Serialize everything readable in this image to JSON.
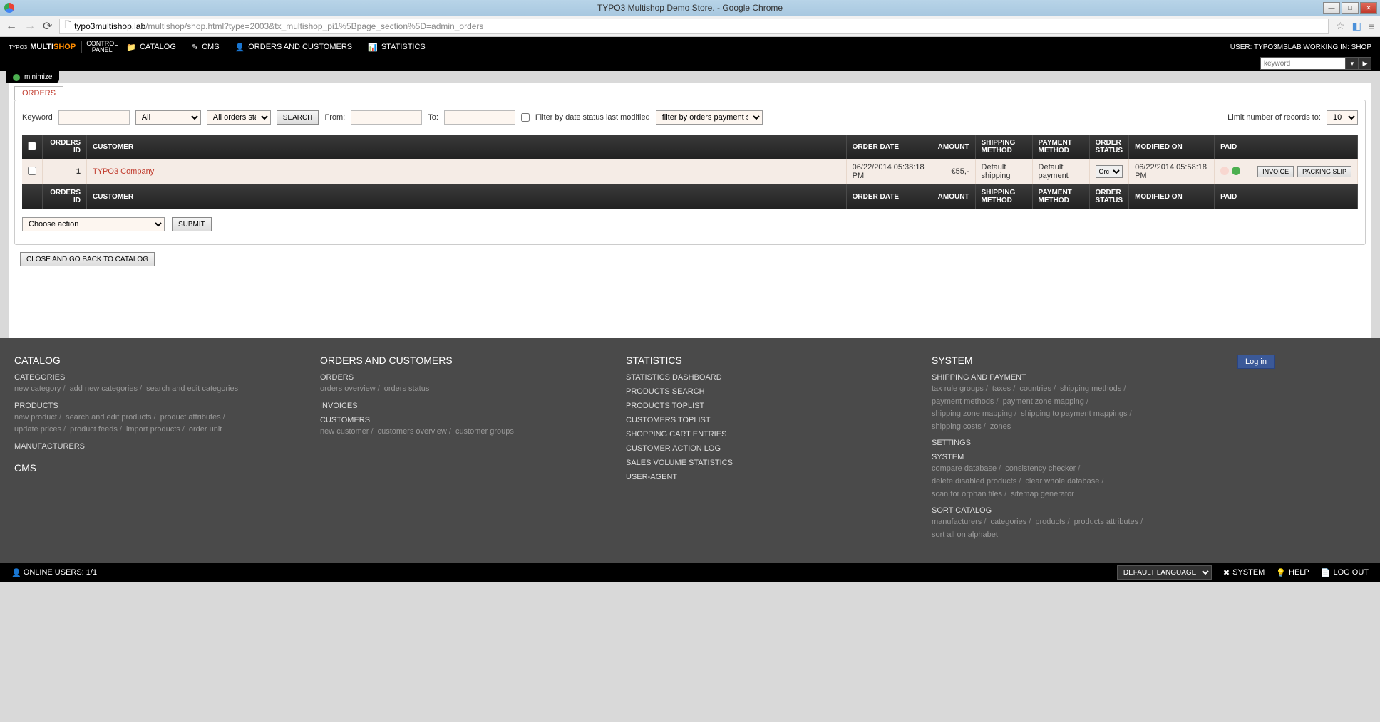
{
  "browser": {
    "title": "TYPO3 Multishop Demo Store. - Google Chrome",
    "url_host": "typo3multishop.lab",
    "url_path": "/multishop/shop.html?type=2003&tx_multishop_pi1%5Bpage_section%5D=admin_orders"
  },
  "topbar": {
    "logo_multi": "MULTI",
    "logo_shop": "SHOP",
    "control": "CONTROL",
    "panel": "PANEL",
    "nav": {
      "catalog": "CATALOG",
      "cms": "CMS",
      "orders": "ORDERS AND CUSTOMERS",
      "stats": "STATISTICS"
    },
    "user_label": "USER: TYPO3MSLAB WORKING IN: SHOP",
    "search_placeholder": "keyword",
    "minimize": "minimize"
  },
  "orders_tab": "ORDERS",
  "filters": {
    "keyword_label": "Keyword",
    "type_select": "All",
    "status_select": "All orders status",
    "search_btn": "SEARCH",
    "from_label": "From:",
    "to_label": "To:",
    "filter_date_label": "Filter by date status last modified",
    "payment_status_select": "filter by orders payment status",
    "limit_label": "Limit number of records to:",
    "limit_value": "10"
  },
  "table": {
    "headers": {
      "orders_id": "ORDERS ID",
      "customer": "CUSTOMER",
      "order_date": "ORDER DATE",
      "amount": "AMOUNT",
      "shipping": "SHIPPING METHOD",
      "payment": "PAYMENT METHOD",
      "status": "ORDER STATUS",
      "modified": "MODIFIED ON",
      "paid": "PAID"
    },
    "row": {
      "id": "1",
      "customer": "TYPO3 Company",
      "date": "06/22/2014 05:38:18 PM",
      "amount": "€55,-",
      "shipping": "Default shipping",
      "payment": "Default payment",
      "status": "Orc",
      "modified": "06/22/2014 05:58:18 PM",
      "invoice_btn": "INVOICE",
      "packing_btn": "PACKING SLIP"
    }
  },
  "actions": {
    "choose": "Choose action",
    "submit": "SUBMIT",
    "close": "CLOSE AND GO BACK TO CATALOG"
  },
  "footer": {
    "catalog": {
      "title": "CATALOG",
      "categories": "CATEGORIES",
      "categories_links": {
        "new": "new category",
        "add": "add new categories",
        "search": "search and edit categories"
      },
      "products": "PRODUCTS",
      "products_links": {
        "new": "new product",
        "search": "search and edit products",
        "attr": "product attributes",
        "upd": "update prices",
        "feeds": "product feeds",
        "import": "import products",
        "unit": "order unit"
      },
      "manufacturers": "MANUFACTURERS",
      "cms": "CMS"
    },
    "orders": {
      "title": "ORDERS AND CUSTOMERS",
      "orders": "ORDERS",
      "orders_links": {
        "ov": "orders overview",
        "st": "orders status"
      },
      "invoices": "INVOICES",
      "customers": "CUSTOMERS",
      "customers_links": {
        "new": "new customer",
        "ov": "customers overview",
        "grp": "customer groups"
      }
    },
    "stats": {
      "title": "STATISTICS",
      "dashboard": "STATISTICS DASHBOARD",
      "psearch": "PRODUCTS SEARCH",
      "ptop": "PRODUCTS TOPLIST",
      "ctop": "CUSTOMERS TOPLIST",
      "cart": "SHOPPING CART ENTRIES",
      "action_log": "CUSTOMER ACTION LOG",
      "sales": "SALES VOLUME STATISTICS",
      "agent": "USER-AGENT"
    },
    "system": {
      "title": "SYSTEM",
      "shipping": "SHIPPING AND PAYMENT",
      "shipping_links": {
        "tax": "tax rule groups",
        "taxes": "taxes",
        "countries": "countries",
        "sm": "shipping methods",
        "pm": "payment methods",
        "pzm": "payment zone mapping",
        "szm": "shipping zone mapping",
        "spm": "shipping to payment mappings",
        "sc": "shipping costs",
        "zones": "zones"
      },
      "settings": "SETTINGS",
      "system_h": "SYSTEM",
      "system_links": {
        "cmp": "compare database",
        "cc": "consistency checker",
        "del": "delete disabled products",
        "clr": "clear whole database",
        "scan": "scan for orphan files",
        "site": "sitemap generator"
      },
      "sort": "SORT CATALOG",
      "sort_links": {
        "man": "manufacturers",
        "cat": "categories",
        "prod": "products",
        "pa": "products attributes",
        "all": "sort all on alphabet"
      }
    },
    "login": "Log in"
  },
  "bottombar": {
    "online": "ONLINE USERS: 1/1",
    "lang": "DEFAULT LANGUAGE",
    "system": "SYSTEM",
    "help": "HELP",
    "logout": "LOG OUT"
  }
}
